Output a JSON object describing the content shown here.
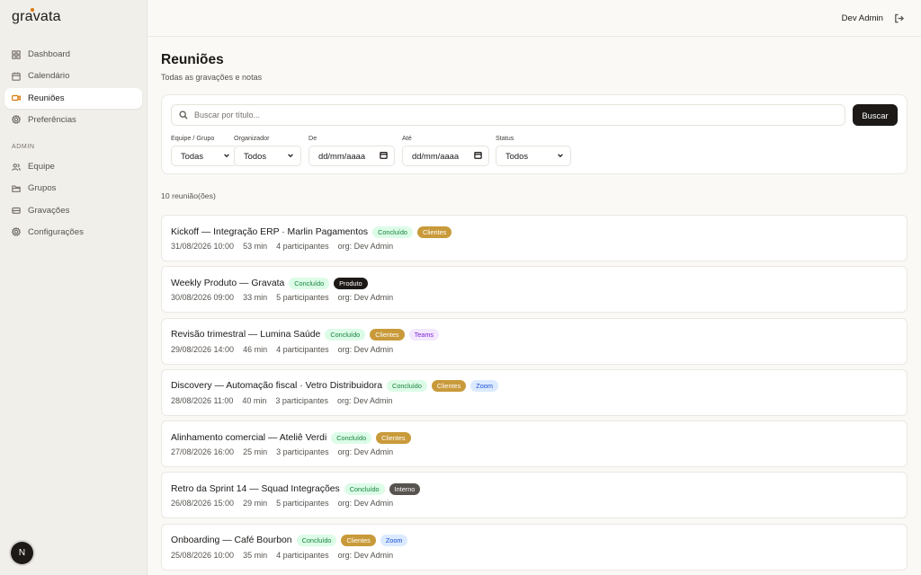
{
  "app": {
    "logo": "gravata"
  },
  "sidebar": {
    "items": [
      {
        "label": "Dashboard",
        "icon": "dashboard-icon"
      },
      {
        "label": "Calendário",
        "icon": "calendar-icon"
      },
      {
        "label": "Reuniões",
        "icon": "video-icon",
        "active": true
      },
      {
        "label": "Preferências",
        "icon": "gear-icon"
      }
    ],
    "admin_label": "ADMIN",
    "admin_items": [
      {
        "label": "Equipe",
        "icon": "users-icon"
      },
      {
        "label": "Grupos",
        "icon": "folder-icon"
      },
      {
        "label": "Gravações",
        "icon": "drive-icon"
      },
      {
        "label": "Configurações",
        "icon": "gear-icon"
      }
    ],
    "avatar": "N"
  },
  "header": {
    "user_name": "Dev Admin"
  },
  "page": {
    "title": "Reuniões",
    "subtitle": "Todas as gravações e notas"
  },
  "filters": {
    "search_placeholder": "Buscar por título...",
    "search_button": "Buscar",
    "team_label": "Equipe / Grupo",
    "team_value": "Todas",
    "organizer_label": "Organizador",
    "organizer_value": "Todos",
    "from_label": "De",
    "from_value": "dd/mm/aaaa",
    "to_label": "Até",
    "to_value": "dd/mm/aaaa",
    "status_label": "Status",
    "status_value": "Todos"
  },
  "results": {
    "count": "10 reunião(ões)"
  },
  "colors": {
    "accent": "#d97706",
    "concluido_bg": "#dcfce7",
    "concluido_fg": "#15803d",
    "clientes_bg": "#c99a3a",
    "clientes_fg": "#ffffff",
    "produto_bg": "#1c1917",
    "produto_fg": "#ffffff",
    "interno_bg": "#57534e",
    "interno_fg": "#ffffff",
    "teams_bg": "#f3e8ff",
    "teams_fg": "#7e22ce",
    "zoom_bg": "#dbeafe",
    "zoom_fg": "#1d4ed8"
  },
  "meetings": [
    {
      "title": "Kickoff — Integração ERP · Marlin Pagamentos",
      "badges": [
        "Concluído",
        "Clientes"
      ],
      "datetime": "31/08/2026 10:00",
      "duration": "53 min",
      "participants": "4 participantes",
      "org": "org: Dev Admin"
    },
    {
      "title": "Weekly Produto — Gravata",
      "badges": [
        "Concluído",
        "Produto"
      ],
      "datetime": "30/08/2026 09:00",
      "duration": "33 min",
      "participants": "5 participantes",
      "org": "org: Dev Admin"
    },
    {
      "title": "Revisão trimestral — Lumina Saúde",
      "badges": [
        "Concluído",
        "Clientes",
        "Teams"
      ],
      "datetime": "29/08/2026 14:00",
      "duration": "46 min",
      "participants": "4 participantes",
      "org": "org: Dev Admin"
    },
    {
      "title": "Discovery — Automação fiscal · Vetro Distribuidora",
      "badges": [
        "Concluído",
        "Clientes",
        "Zoom"
      ],
      "datetime": "28/08/2026 11:00",
      "duration": "40 min",
      "participants": "3 participantes",
      "org": "org: Dev Admin"
    },
    {
      "title": "Alinhamento comercial — Ateliê Verdi",
      "badges": [
        "Concluído",
        "Clientes"
      ],
      "datetime": "27/08/2026 16:00",
      "duration": "25 min",
      "participants": "3 participantes",
      "org": "org: Dev Admin"
    },
    {
      "title": "Retro da Sprint 14 — Squad Integrações",
      "badges": [
        "Concluído",
        "Interno"
      ],
      "datetime": "26/08/2026 15:00",
      "duration": "29 min",
      "participants": "5 participantes",
      "org": "org: Dev Admin"
    },
    {
      "title": "Onboarding — Café Bourbon",
      "badges": [
        "Concluído",
        "Clientes",
        "Zoom"
      ],
      "datetime": "25/08/2026 10:00",
      "duration": "35 min",
      "participants": "4 participantes",
      "org": "org: Dev Admin"
    }
  ]
}
